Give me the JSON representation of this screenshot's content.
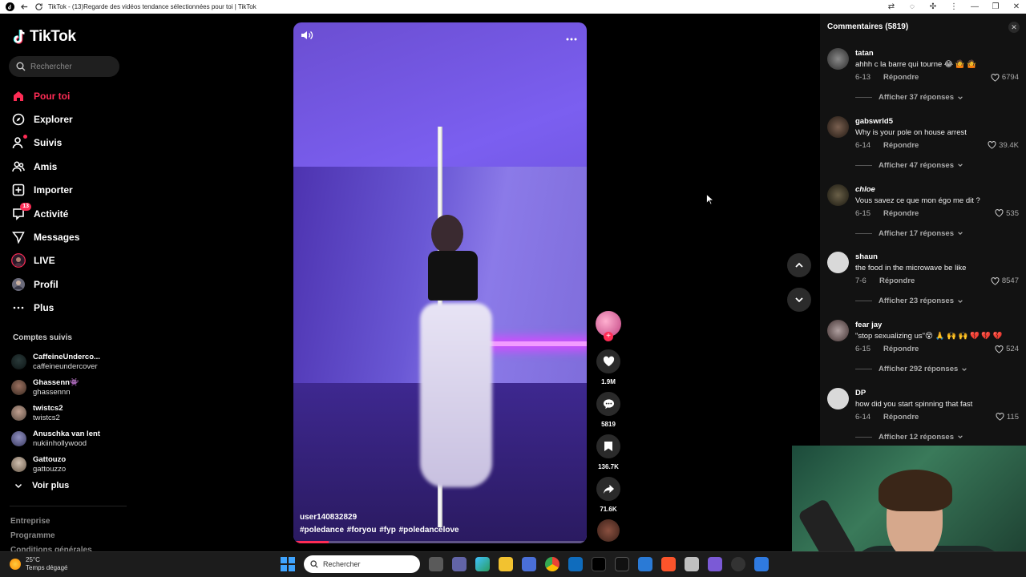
{
  "browser": {
    "tab_title": "TikTok - (13)Regarde des vidéos tendance sélectionnées pour toi | TikTok"
  },
  "sidebar": {
    "logo_text": "TikTok",
    "search_placeholder": "Rechercher",
    "nav": [
      {
        "label": "Pour toi",
        "icon": "home-icon",
        "active": true
      },
      {
        "label": "Explorer",
        "icon": "compass-icon"
      },
      {
        "label": "Suivis",
        "icon": "following-icon"
      },
      {
        "label": "Amis",
        "icon": "friends-icon"
      },
      {
        "label": "Importer",
        "icon": "upload-icon"
      },
      {
        "label": "Activité",
        "icon": "inbox-icon",
        "badge": "13"
      },
      {
        "label": "Messages",
        "icon": "send-icon"
      },
      {
        "label": "LIVE",
        "icon": "live-icon"
      },
      {
        "label": "Profil",
        "icon": "profile-icon"
      },
      {
        "label": "Plus",
        "icon": "more-icon"
      }
    ],
    "following_title": "Comptes suivis",
    "following": [
      {
        "name": "CaffeineUnderco...",
        "user": "caffeineundercover"
      },
      {
        "name": "Ghassenn👾",
        "user": "ghassennn"
      },
      {
        "name": "twistcs2",
        "user": "twistcs2"
      },
      {
        "name": "Anuschka van lent",
        "user": "nukiinhollywood"
      },
      {
        "name": "Gattouzo",
        "user": "gattouzzo"
      }
    ],
    "see_more": "Voir plus",
    "footer": [
      "Entreprise",
      "Programme",
      "Conditions générales"
    ]
  },
  "video": {
    "username": "user140832829",
    "hashtags": "#poledance #foryou #fyp #poledancelove",
    "progress": 0.12
  },
  "actions": {
    "likes": "1.9M",
    "comments": "5819",
    "saves": "136.7K",
    "shares": "71.6K"
  },
  "comments": {
    "header": "Commentaires (5819)",
    "reply_label": "Répondre",
    "items": [
      {
        "user": "tatan",
        "text": "ahhh c la barre qui tourne 😂 🤷 🤷",
        "date": "6-13",
        "likes": "6794",
        "replies": "Afficher 37 réponses"
      },
      {
        "user": "gabswrld5",
        "text": "Why is your pole on house arrest",
        "date": "6-14",
        "likes": "39.4K",
        "replies": "Afficher 47 réponses"
      },
      {
        "user": "chloe",
        "text": "Vous savez ce que mon égo me dit ?",
        "date": "6-15",
        "likes": "535",
        "replies": "Afficher 17 réponses"
      },
      {
        "user": "shaun",
        "text": "the food in the microwave be like",
        "date": "7-6",
        "likes": "8547",
        "replies": "Afficher 23 réponses"
      },
      {
        "user": "fear jay",
        "text": "\"stop sexualizing us\"😵 🙏 🙌 🙌 💔 💔 💔",
        "date": "6-15",
        "likes": "524",
        "replies": "Afficher 292 réponses"
      },
      {
        "user": "DP",
        "text": "how did you start spinning that fast",
        "date": "6-14",
        "likes": "115",
        "replies": "Afficher 12 réponses"
      }
    ]
  },
  "taskbar": {
    "temperature": "25°C",
    "weather": "Temps dégagé",
    "search_placeholder": "Rechercher"
  },
  "colors": {
    "accent": "#fe2c55",
    "background": "#000000",
    "panel": "#121212"
  }
}
